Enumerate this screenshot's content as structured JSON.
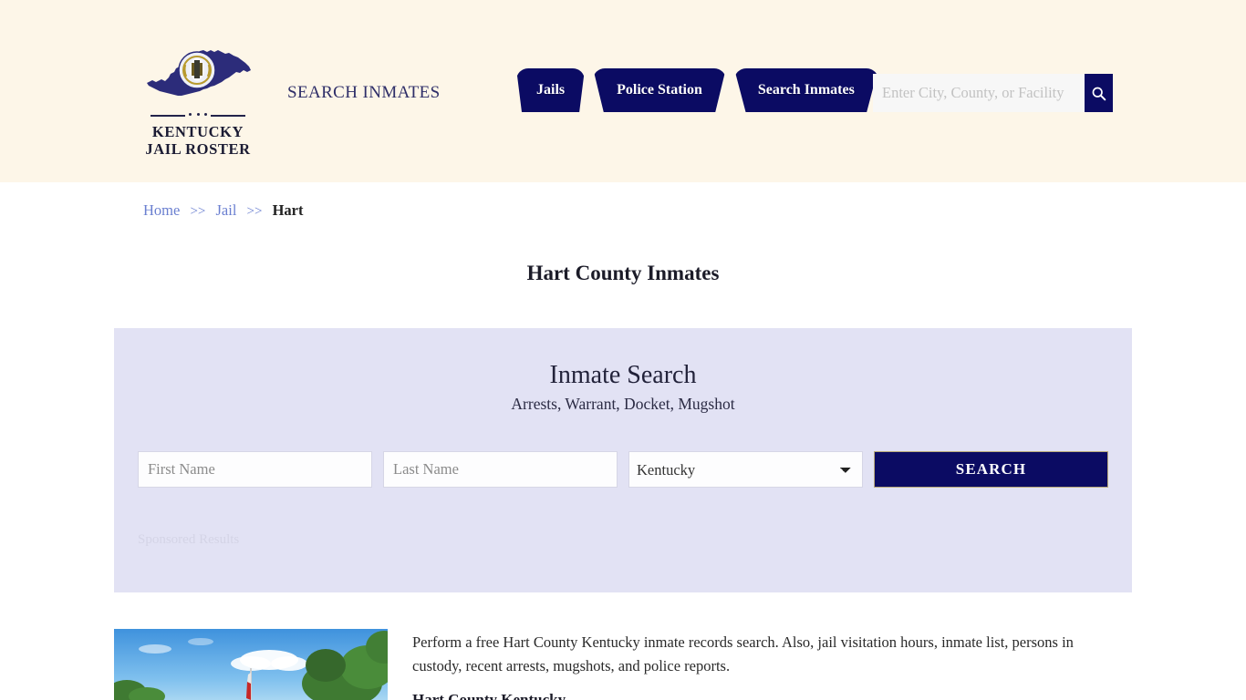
{
  "header": {
    "logo": {
      "icon": "kentucky-state-map-icon",
      "line1": "KENTUCKY",
      "line2": "JAIL ROSTER"
    },
    "tagline": "SEARCH INMATES",
    "nav": [
      {
        "label": "Jails",
        "name": "nav-jails"
      },
      {
        "label": "Police Station",
        "name": "nav-police-station"
      },
      {
        "label": "Search Inmates",
        "name": "nav-search-inmates"
      }
    ],
    "search": {
      "placeholder": "Enter City, County, or Facility",
      "value": "",
      "button_icon": "search-icon"
    },
    "background_color": "#fdf6e8"
  },
  "breadcrumb": {
    "home": "Home",
    "sep1": ">>",
    "jail": "Jail",
    "sep2": ">>",
    "current": "Hart"
  },
  "page_title": "Hart County Inmates",
  "search_panel": {
    "heading": "Inmate Search",
    "subheading": "Arrests, Warrant, Docket, Mugshot",
    "first_name_placeholder": "First Name",
    "first_name_value": "",
    "last_name_placeholder": "Last Name",
    "last_name_value": "",
    "state_selected": "Kentucky",
    "state_options": [
      "Kentucky"
    ],
    "search_button": "SEARCH",
    "sponsored_label": "Sponsored Results",
    "background_color": "#e2e2f4",
    "accent_color": "#0b0b63"
  },
  "content": {
    "photo_alt": "county-flagpole-photo",
    "paragraph": "Perform a free Hart County Kentucky inmate records search. Also, jail visitation hours, inmate list, persons in custody, recent arrests, mugshots, and police reports.",
    "subheading": "Hart County Kentucky"
  }
}
